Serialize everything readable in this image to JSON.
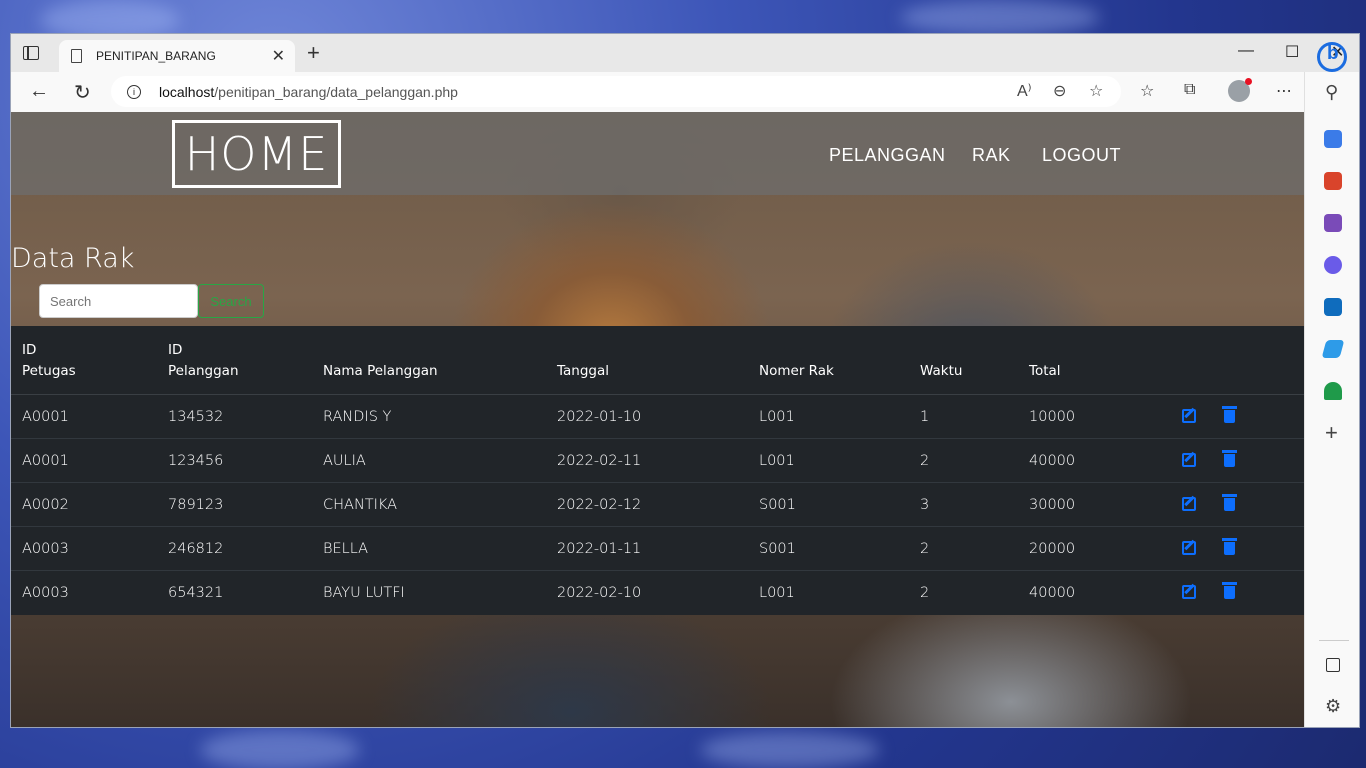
{
  "browser": {
    "tab_title": "PENITIPAN_BARANG",
    "url_host": "localhost",
    "url_path": "/penitipan_barang/data_pelanggan.php"
  },
  "navbar": {
    "brand": "HOME",
    "menu": [
      "PELANGGAN",
      "RAK",
      "LOGOUT"
    ]
  },
  "page": {
    "heading": "Data Rak",
    "search_placeholder": "Search",
    "search_button": "Search"
  },
  "table": {
    "headers": [
      {
        "line1": "ID",
        "line2": "Petugas"
      },
      {
        "line1": "ID",
        "line2": "Pelanggan"
      },
      {
        "line1": "",
        "line2": "Nama Pelanggan"
      },
      {
        "line1": "",
        "line2": "Tanggal"
      },
      {
        "line1": "",
        "line2": "Nomer Rak"
      },
      {
        "line1": "",
        "line2": "Waktu"
      },
      {
        "line1": "",
        "line2": "Total"
      }
    ],
    "rows": [
      [
        "A0001",
        "134532",
        "RANDIS Y",
        "2022-01-10",
        "L001",
        "1",
        "10000"
      ],
      [
        "A0001",
        "123456",
        "AULIA",
        "2022-02-11",
        "L001",
        "2",
        "40000"
      ],
      [
        "A0002",
        "789123",
        "CHANTIKA",
        "2022-02-12",
        "S001",
        "3",
        "30000"
      ],
      [
        "A0003",
        "246812",
        "BELLA",
        "2022-01-11",
        "S001",
        "2",
        "20000"
      ],
      [
        "A0003",
        "654321",
        "BAYU LUTFI",
        "2022-02-10",
        "L001",
        "2",
        "40000"
      ]
    ]
  },
  "colors": {
    "action_blue": "#0d6efd",
    "search_green": "#28a745",
    "table_bg": "#212529"
  }
}
